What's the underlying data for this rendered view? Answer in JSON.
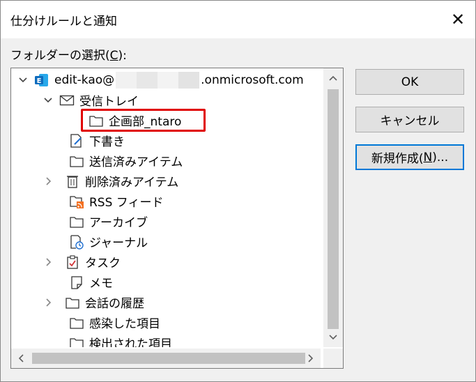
{
  "window": {
    "title": "仕分けルールと通知",
    "close_glyph": "✕"
  },
  "folder_selection": {
    "label_prefix": "フォルダーの選択(",
    "label_accel": "C",
    "label_suffix": "):"
  },
  "tree": {
    "account": {
      "name_prefix": "edit-kao@",
      "name_suffix": ".onmicrosoft.com",
      "icon": "outlook-exchange-icon",
      "brand_color": "#0f6cbd"
    },
    "items": [
      {
        "label": "受信トレイ",
        "icon": "envelope-icon",
        "expander": "expanded"
      },
      {
        "label": "企画部_ntaro",
        "icon": "folder-icon",
        "expander": "none",
        "selected": true
      },
      {
        "label": "下書き",
        "icon": "drafts-icon",
        "expander": "none"
      },
      {
        "label": "送信済みアイテム",
        "icon": "folder-icon",
        "expander": "none"
      },
      {
        "label": "削除済みアイテム",
        "icon": "trash-icon",
        "expander": "collapsed"
      },
      {
        "label": "RSS フィード",
        "icon": "rss-folder-icon",
        "expander": "none"
      },
      {
        "label": "アーカイブ",
        "icon": "folder-icon",
        "expander": "none"
      },
      {
        "label": "ジャーナル",
        "icon": "journal-icon",
        "expander": "none"
      },
      {
        "label": "タスク",
        "icon": "task-icon",
        "expander": "collapsed"
      },
      {
        "label": "メモ",
        "icon": "note-icon",
        "expander": "none"
      },
      {
        "label": "会話の履歴",
        "icon": "folder-icon",
        "expander": "collapsed"
      },
      {
        "label": "感染した項目",
        "icon": "folder-icon",
        "expander": "none"
      },
      {
        "label": "検出された項目",
        "icon": "folder-icon",
        "expander": "none"
      }
    ],
    "highlight_color": "#e00000"
  },
  "buttons": {
    "ok": "OK",
    "cancel": "キャンセル",
    "new_prefix": "新規作成(",
    "new_accel": "N",
    "new_suffix": ")..."
  }
}
